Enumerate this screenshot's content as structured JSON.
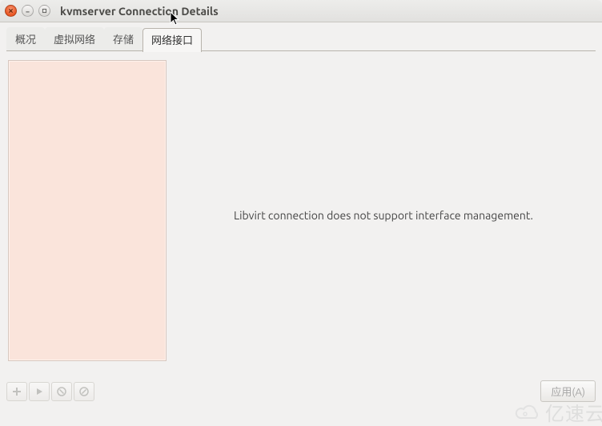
{
  "window": {
    "title": "kvmserver Connection Details"
  },
  "tabs": {
    "items": [
      {
        "label": "概况"
      },
      {
        "label": "虚拟网络"
      },
      {
        "label": "存储"
      },
      {
        "label": "网络接口"
      }
    ],
    "active_index": 3
  },
  "detail": {
    "message": "Libvirt connection does not support interface management."
  },
  "toolbar": {
    "add_label": "add",
    "start_label": "start",
    "stop_label": "stop",
    "delete_label": "delete",
    "apply_label": "应用(A)"
  },
  "watermark": {
    "text": "亿速云"
  }
}
